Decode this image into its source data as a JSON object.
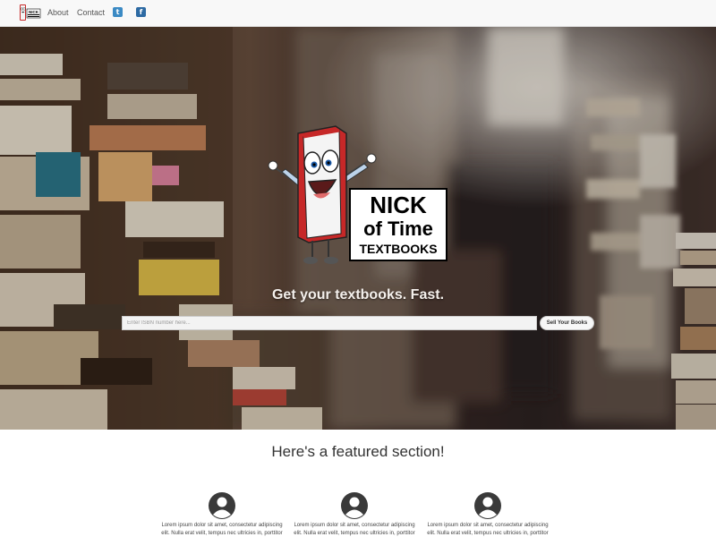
{
  "nav": {
    "brand_alt": "Nick of Time Textbooks",
    "brand_mini": "NICK",
    "links": [
      "About",
      "Contact"
    ],
    "social": [
      {
        "icon": "twitter-icon",
        "glyph": "t",
        "color": "#3b8ac4"
      },
      {
        "icon": "facebook-icon",
        "glyph": "f",
        "color": "#2d6aa3"
      }
    ]
  },
  "hero": {
    "logo": {
      "line1": "NICK",
      "line2": "of Time",
      "line3": "TEXTBOOKS"
    },
    "tagline": "Get your textbooks. Fast.",
    "search_placeholder": "Enter ISBN number here...",
    "sell_button": "Sell Your Books"
  },
  "featured": {
    "title": "Here's a featured section!",
    "items": [
      {
        "icon": "user-avatar-icon",
        "text": "Lorem ipsum dolor sit amet, consectetur adipiscing elit. Nulla erat velit, tempus nec ultricies in, porttitor"
      },
      {
        "icon": "user-avatar-icon",
        "text": "Lorem ipsum dolor sit amet, consectetur adipiscing elit. Nulla erat velit, tempus nec ultricies in, porttitor"
      },
      {
        "icon": "user-avatar-icon",
        "text": "Lorem ipsum dolor sit amet, consectetur adipiscing elit. Nulla erat velit, tempus nec ultricies in, porttitor"
      }
    ]
  },
  "colors": {
    "navbar_bg": "#f8f8f8",
    "book_red": "#c62828",
    "avatar": "#3a3a3a",
    "tagline": "#f4f0ec"
  }
}
